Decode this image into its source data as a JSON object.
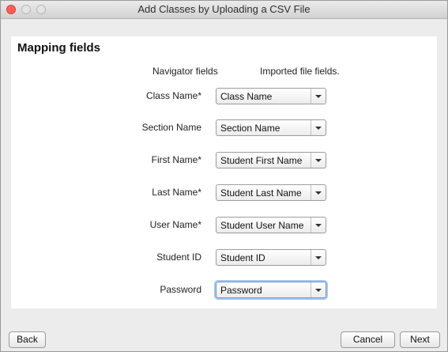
{
  "window": {
    "title": "Add Classes by Uploading a CSV File"
  },
  "section": {
    "heading": "Mapping fields"
  },
  "columns": {
    "navigator": "Navigator fields",
    "imported": "Imported file fields."
  },
  "rows": [
    {
      "label": "Class Name*",
      "value": "Class Name"
    },
    {
      "label": "Section Name",
      "value": "Section Name"
    },
    {
      "label": "First Name*",
      "value": "Student First Name"
    },
    {
      "label": "Last Name*",
      "value": "Student Last Name"
    },
    {
      "label": "User Name*",
      "value": "Student User Name"
    },
    {
      "label": "Student ID",
      "value": "Student ID"
    },
    {
      "label": "Password",
      "value": "Password"
    }
  ],
  "buttons": {
    "back": "Back",
    "cancel": "Cancel",
    "next": "Next"
  },
  "icons": {
    "close": "close-icon",
    "minimize": "minimize-icon",
    "zoom": "zoom-icon",
    "dropdown": "chevron-down-icon"
  },
  "colors": {
    "close_button": "#ff5f57",
    "focus_ring": "#a9c6ec",
    "window_background": "#ececec"
  }
}
